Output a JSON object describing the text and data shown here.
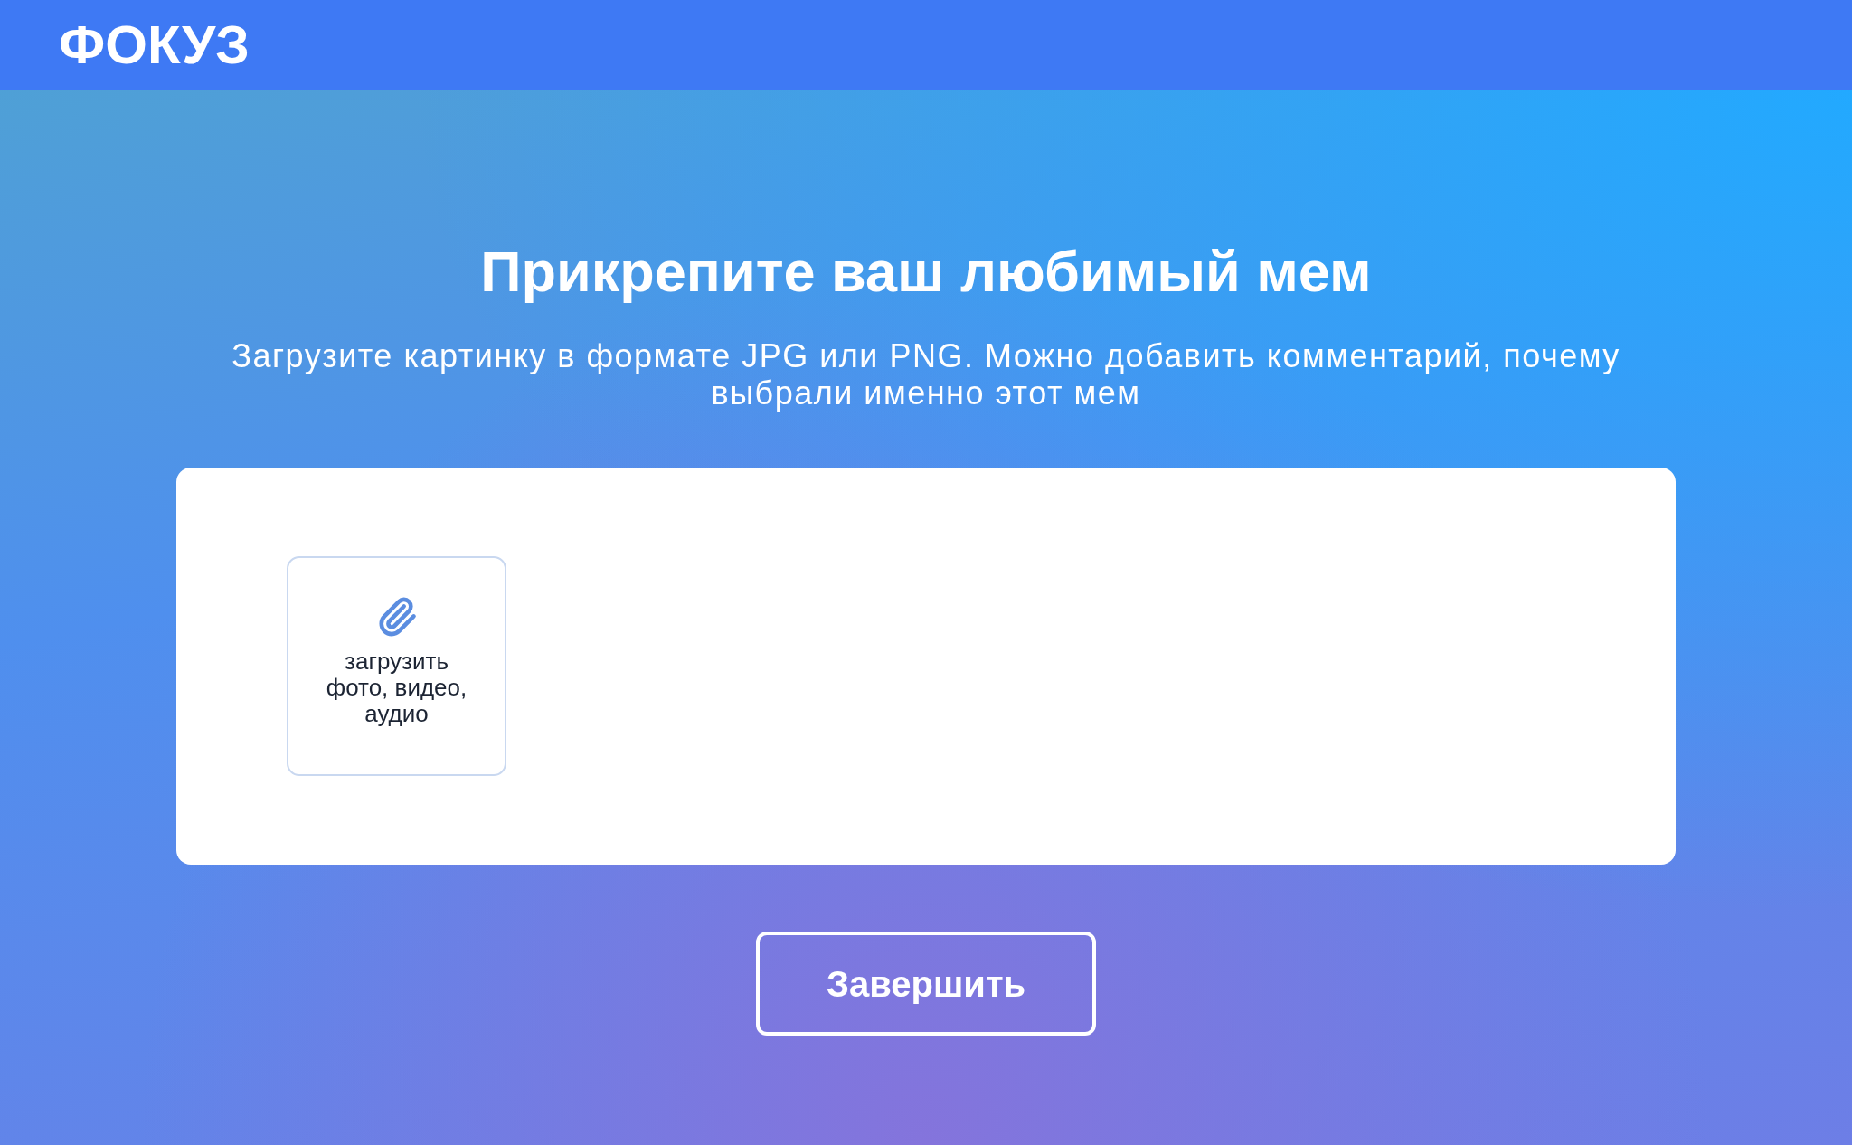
{
  "header": {
    "logo": "ФОКУЗ"
  },
  "page": {
    "title": "Прикрепите ваш любимый мем",
    "subtitle": "Загрузите картинку в формате JPG или PNG. Можно добавить комментарий, почему выбрали именно этот мем"
  },
  "upload_card": {
    "upload_tile": {
      "label": "загрузить фото, видео, аудио"
    }
  },
  "buttons": [
    {
      "label": "Завершить"
    }
  ]
}
